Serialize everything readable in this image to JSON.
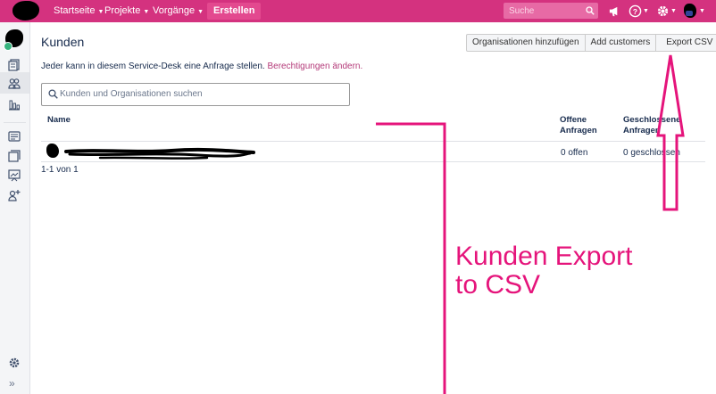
{
  "colors": {
    "topbar": "#d4327f",
    "accent_link": "#b43a79",
    "annotation": "#e5147b",
    "success_badge": "#36b37e"
  },
  "topnav": {
    "items": [
      {
        "label": "Startseite"
      },
      {
        "label": "Projekte"
      },
      {
        "label": "Vorgänge"
      }
    ],
    "create_label": "Erstellen",
    "search_placeholder": "Suche",
    "icons": [
      "search-icon",
      "megaphone-icon",
      "help-icon",
      "gear-icon"
    ]
  },
  "sidebar": {
    "icons": [
      "queues-icon",
      "customers-icon",
      "reports-icon",
      "knowledge-base-icon",
      "channels-icon",
      "raise-request-icon",
      "invite-team-icon",
      "settings-icon",
      "expand-icon"
    ]
  },
  "main": {
    "title": "Kunden",
    "buttons": {
      "add_organizations": "Organisationen hinzufügen",
      "add_customers": "Add customers",
      "export_csv": "Export CSV"
    },
    "info_text": "Jeder kann in diesem Service-Desk eine Anfrage stellen.",
    "info_link": "Berechtigungen ändern.",
    "search_placeholder": "Kunden und Organisationen suchen",
    "table": {
      "headers": {
        "name": "Name",
        "open": "Offene Anfragen",
        "closed": "Geschlossene Anfragen"
      },
      "rows": [
        {
          "open": "0 offen",
          "closed": "0 geschlossen"
        }
      ]
    },
    "pager": "1-1 von 1"
  },
  "annotation": {
    "line1": "Kunden Export",
    "line2": "to CSV"
  }
}
